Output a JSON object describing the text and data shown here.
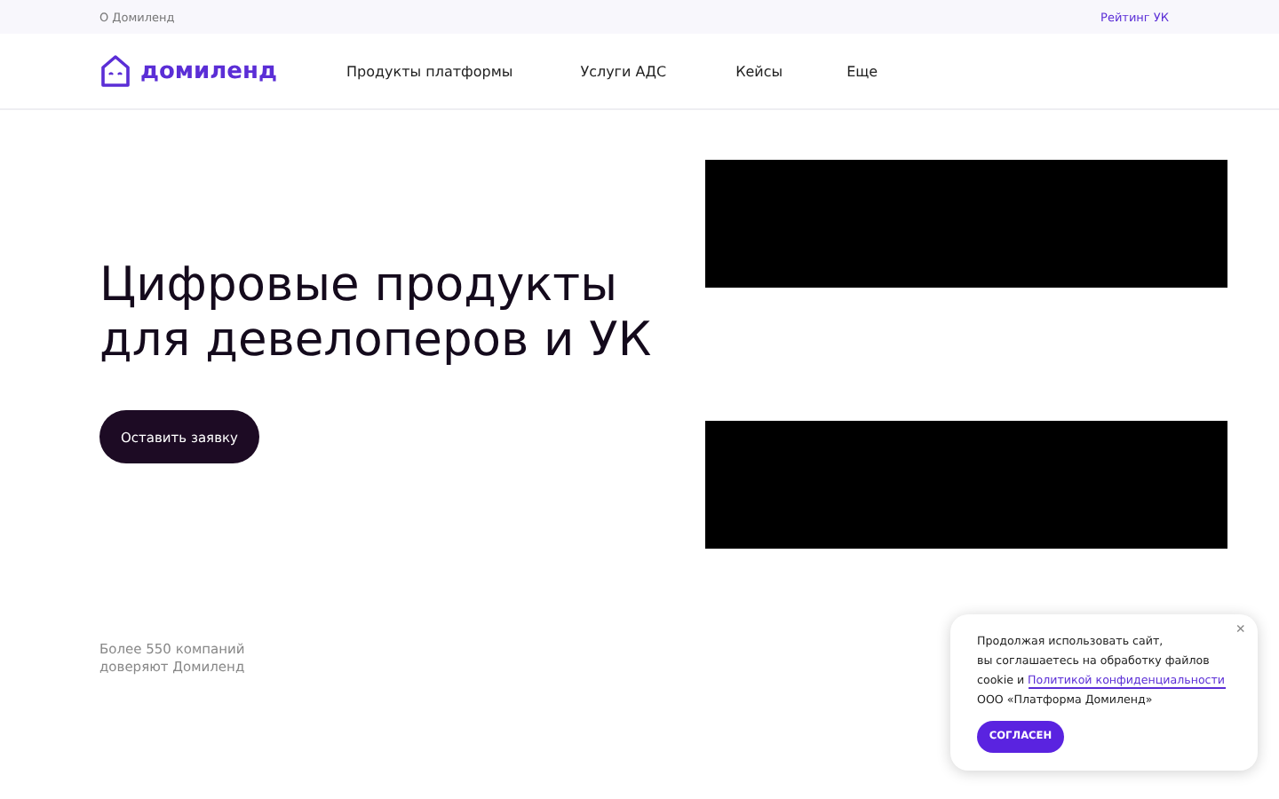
{
  "top_bar": {
    "left_link": "О Домиленд",
    "right_link": "Рейтинг УК"
  },
  "header": {
    "logo_text": "домиленд",
    "nav": [
      "Продукты платформы",
      "Услуги АДС",
      "Кейсы",
      "Еще"
    ]
  },
  "hero": {
    "title_lines": [
      "Цифровые продукты",
      "для девелоперов и УК"
    ],
    "button": "Оставить заявку",
    "trust_lines": [
      "Более 550 компаний",
      "доверяют Домиленд"
    ]
  },
  "cookie_notice": {
    "text_lines": [
      "Продолжая использовать сайт,",
      "вы соглашаетесь на обработку файлов"
    ],
    "text_prefix": "cookie и ",
    "link": "Политикой конфиденциальности",
    "text_suffix": "ООО «Платформа Домиленд»",
    "close": "×",
    "button": "СОГЛАСЕН"
  }
}
